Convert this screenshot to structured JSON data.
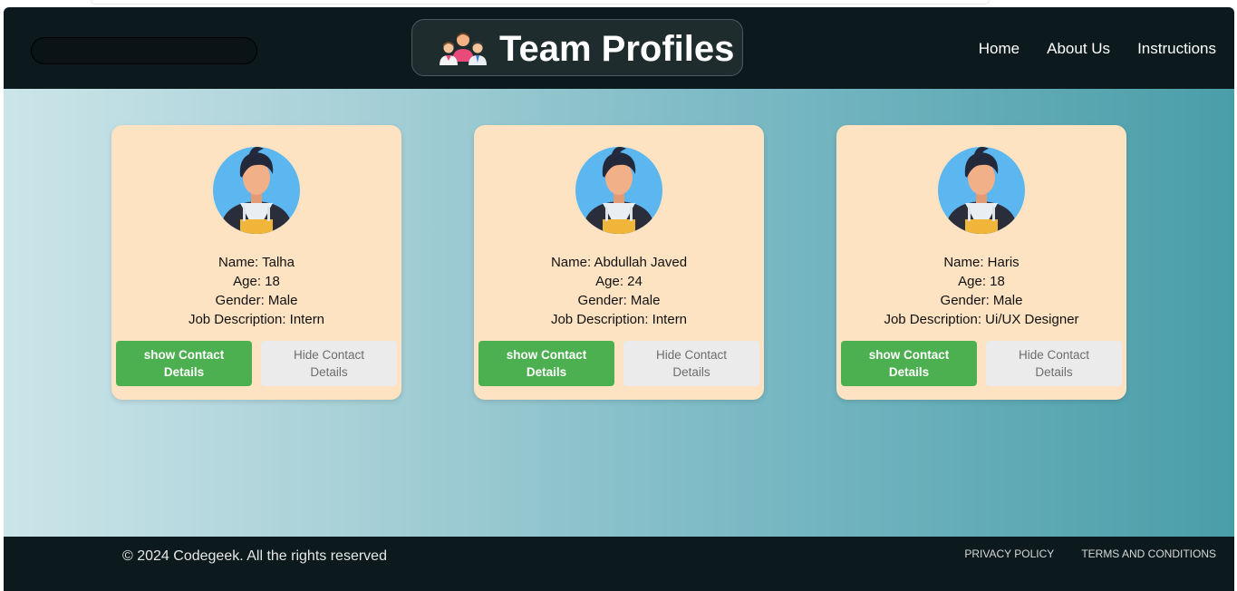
{
  "header": {
    "title": "Team Profiles",
    "brand_icon": "team-icon",
    "nav": [
      "Home",
      "About Us",
      "Instructions"
    ]
  },
  "cards": [
    {
      "name": "Name: Talha",
      "age": "Age: 18",
      "gender": "Gender: Male",
      "job": "Job Description: Intern",
      "show_label": "show Contact Details",
      "hide_label": "Hide Contact Details"
    },
    {
      "name": "Name: Abdullah Javed",
      "age": "Age: 24",
      "gender": "Gender: Male",
      "job": "Job Description: Intern",
      "show_label": "show Contact Details",
      "hide_label": "Hide Contact Details"
    },
    {
      "name": "Name: Haris",
      "age": "Age: 18",
      "gender": "Gender: Male",
      "job": "Job Description: Ui/UX Designer",
      "show_label": "show Contact Details",
      "hide_label": "Hide Contact Details"
    }
  ],
  "footer": {
    "copyright": "© 2024 Codegeek. All the rights reserved",
    "links": [
      "PRIVACY POLICY",
      "TERMS AND CONDITIONS"
    ]
  },
  "colors": {
    "header_bg": "#0c1a1d",
    "card_bg": "#fde3c1",
    "show_button": "#4cb050",
    "hide_button": "#ebebeb"
  }
}
